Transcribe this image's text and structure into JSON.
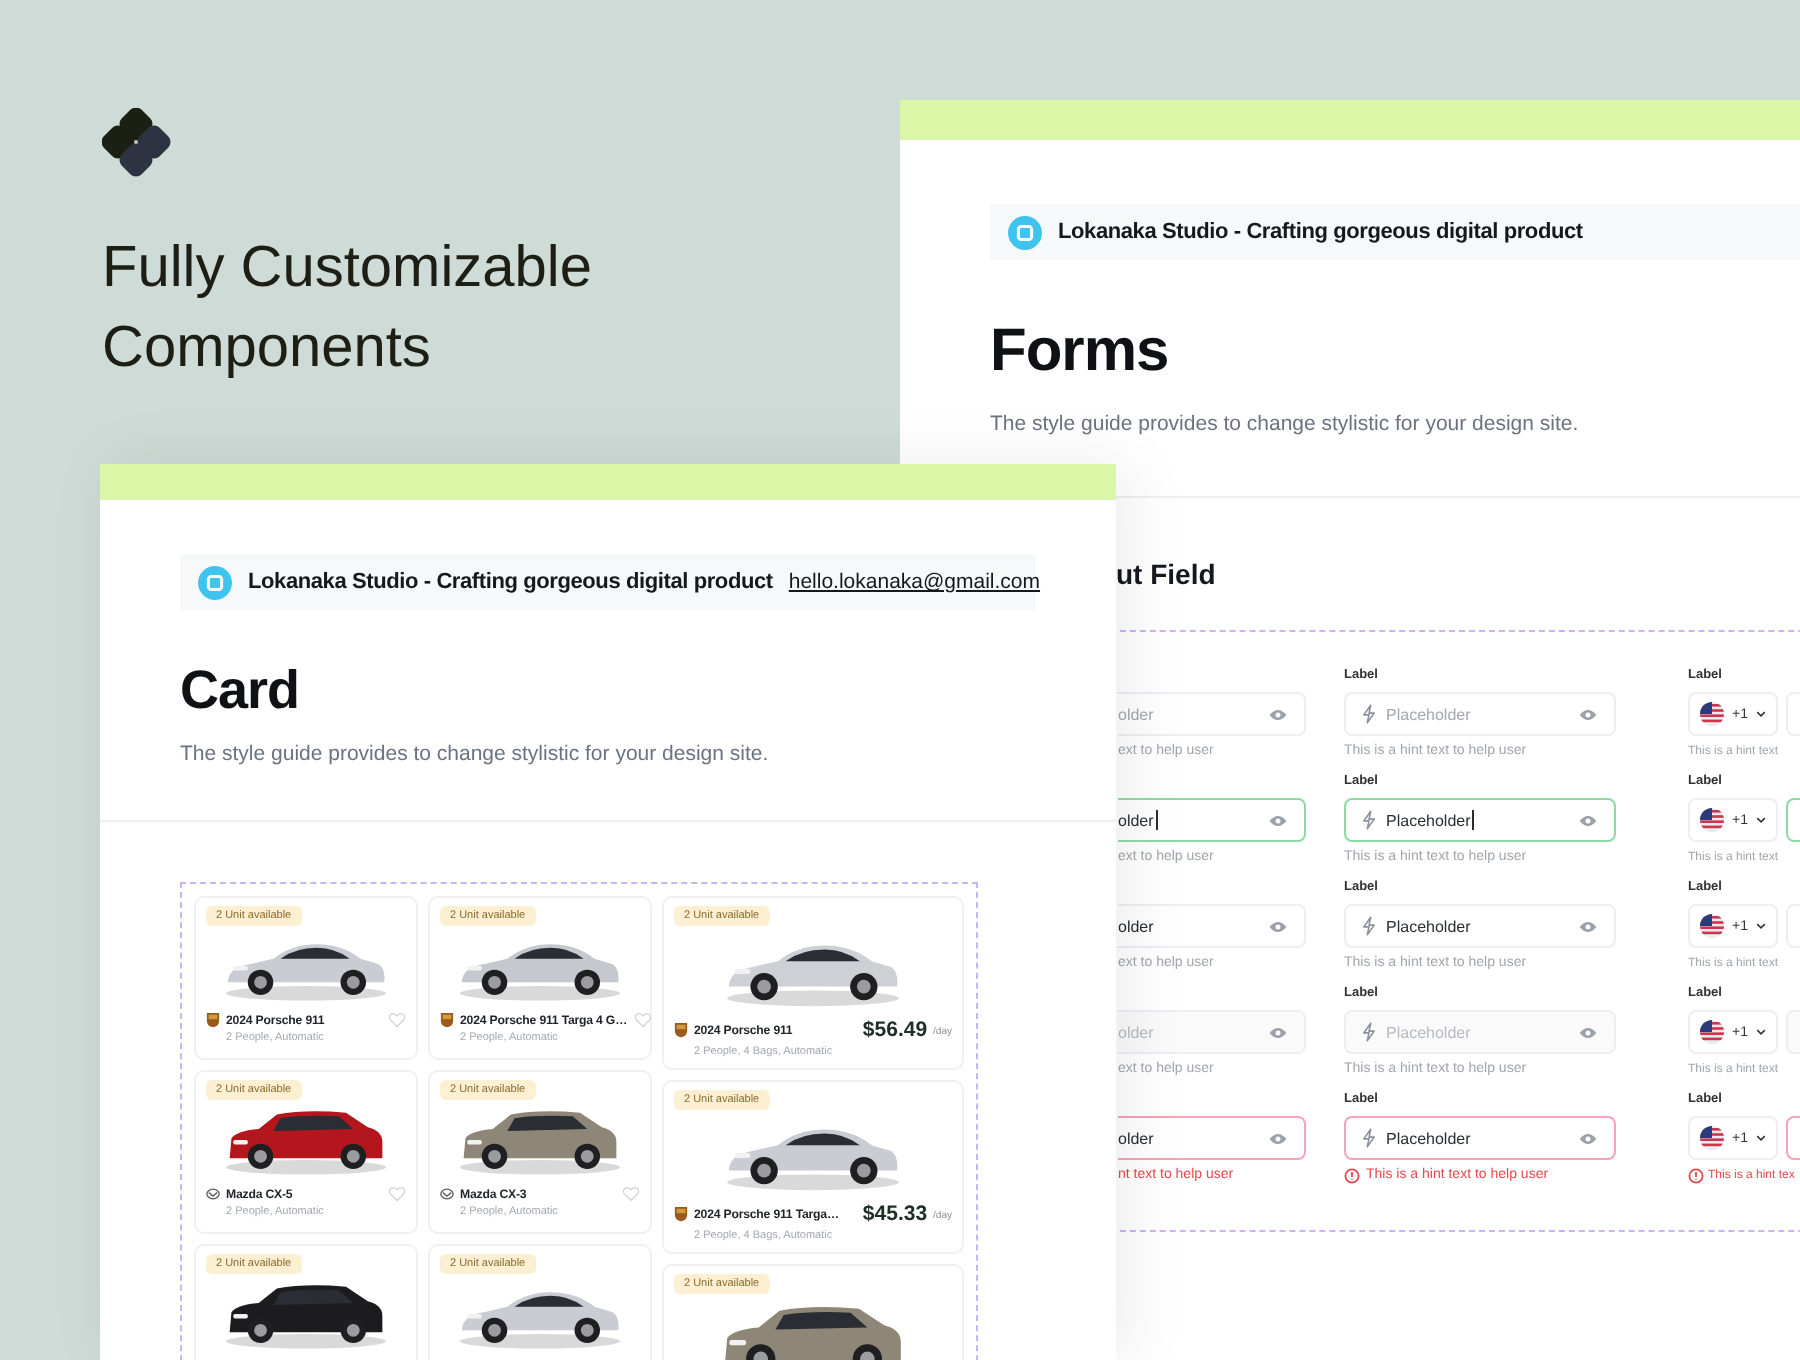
{
  "brand": {
    "headline": "Fully Customizable Components"
  },
  "forms_page": {
    "header": {
      "title": "Lokanaka Studio - Crafting gorgeous digital product"
    },
    "title": "Forms",
    "subtitle": "The style guide provides to change stylistic for your design site.",
    "section_title": "ut Field",
    "rows": [
      {
        "kind": "default",
        "col_1": {
          "placeholder": "older",
          "hint": "ext to help user"
        },
        "col_2": {
          "label": "Label",
          "placeholder": "Placeholder",
          "hint": "This is a hint text to help user"
        },
        "col_3": {
          "label": "Label",
          "code": "+1",
          "hint": "This is a hint text"
        }
      },
      {
        "kind": "focused",
        "col_1": {
          "value": "older",
          "hint": "ext to help user"
        },
        "col_2": {
          "label": "Label",
          "value": "Placeholder",
          "hint": "This is a hint text to help user"
        },
        "col_3": {
          "label": "Label",
          "code": "+1",
          "hint": "This is a hint text"
        }
      },
      {
        "kind": "filled",
        "col_1": {
          "value": "older",
          "hint": "ext to help user"
        },
        "col_2": {
          "label": "Label",
          "value": "Placeholder",
          "hint": "This is a hint text to help user"
        },
        "col_3": {
          "label": "Label",
          "code": "+1",
          "hint": "This is a hint text"
        }
      },
      {
        "kind": "disabled",
        "col_1": {
          "placeholder": "older",
          "hint": "ext to help user"
        },
        "col_2": {
          "label": "Label",
          "placeholder": "Placeholder",
          "hint": "This is a hint text to help user"
        },
        "col_3": {
          "label": "Label",
          "code": "+1",
          "hint": "This is a hint text"
        }
      },
      {
        "kind": "error",
        "col_1": {
          "value": "older",
          "hint": "nt text to help user"
        },
        "col_2": {
          "label": "Label",
          "value": "Placeholder",
          "hint": "This is a hint text to help user"
        },
        "col_3": {
          "label": "Label",
          "code": "+1",
          "hint": "This is a hint tex"
        }
      }
    ]
  },
  "card_page": {
    "header": {
      "title": "Lokanaka Studio - Crafting gorgeous digital product",
      "email": "hello.lokanaka@gmail.com"
    },
    "title": "Card",
    "subtitle": "The style guide provides to change stylistic for your design site.",
    "cards": [
      {
        "kind": "compact",
        "badge": "2 Unit available",
        "brand_logo": {
          "kind": "shield"
        },
        "name": "2024 Porsche 911",
        "specs": "2 People, Automatic"
      },
      {
        "kind": "compact",
        "badge": "2 Unit available",
        "brand_logo": {
          "kind": "shield"
        },
        "name": "2024 Porsche 911 Targa 4 G…",
        "specs": "2 People, Automatic"
      },
      {
        "kind": "priced",
        "badge": "2 Unit available",
        "brand_logo": {
          "kind": "shield"
        },
        "name": "2024 Porsche 911",
        "specs": "2 People, 4 Bags, Automatic",
        "price": "$56.49",
        "unit": "/day"
      },
      {
        "kind": "compact",
        "badge": "2 Unit available",
        "brand_logo": {
          "kind": "ring"
        },
        "name": "Mazda CX-5",
        "specs": "2 People, Automatic"
      },
      {
        "kind": "compact",
        "badge": "2 Unit available",
        "brand_logo": {
          "kind": "ring"
        },
        "name": "Mazda CX-3",
        "specs": "2 People, Automatic"
      },
      {
        "kind": "priced",
        "badge": "2 Unit available",
        "brand_logo": {
          "kind": "shield"
        },
        "name": "2024 Porsche 911 Targa…",
        "specs": "2 People, 4 Bags, Automatic",
        "price": "$45.33",
        "unit": "/day"
      },
      {
        "kind": "compact",
        "badge": "2 Unit available"
      },
      {
        "kind": "compact",
        "badge": "2 Unit available"
      },
      {
        "kind": "priced",
        "badge": "2 Unit available"
      }
    ]
  }
}
